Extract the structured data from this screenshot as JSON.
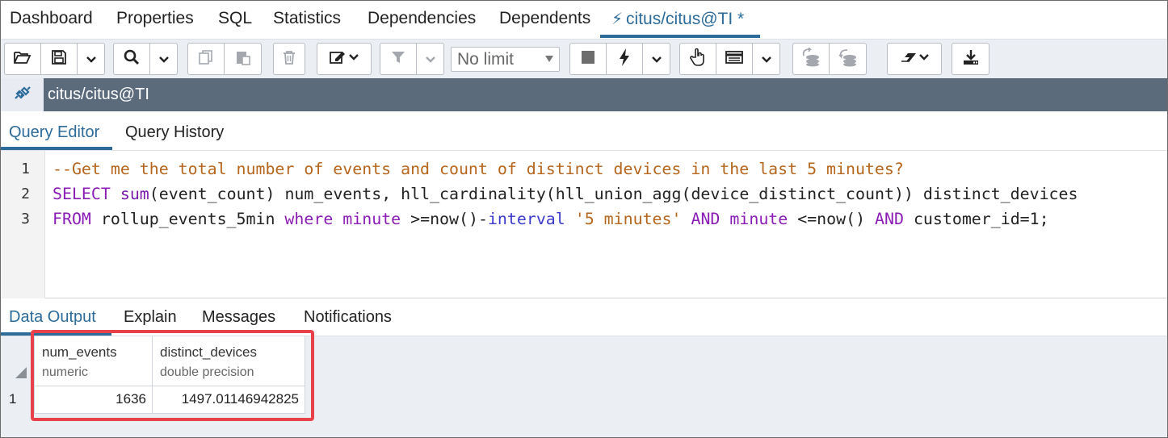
{
  "top_tabs": {
    "dashboard": "Dashboard",
    "properties": "Properties",
    "sql": "SQL",
    "statistics": "Statistics",
    "dependencies": "Dependencies",
    "dependents": "Dependents",
    "query_tab": "citus/citus@TI *"
  },
  "toolbar": {
    "row_limit": "No limit"
  },
  "connection": {
    "label": "citus/citus@TI"
  },
  "editor_tabs": {
    "query_editor": "Query Editor",
    "query_history": "Query History"
  },
  "editor": {
    "line_numbers": [
      "1",
      "2",
      "3"
    ],
    "line1": {
      "comment": "--Get me the total number of events and count of distinct devices in the last 5 minutes?"
    },
    "line2": {
      "kw_select": "SELECT",
      "fn_sum": "sum",
      "p1": "(",
      "arg1": "event_count",
      "p2": ")",
      "alias1": " num_events, hll_cardinality",
      "p3": "(",
      "fn_inner": "hll_union_agg",
      "p4": "(",
      "arg2": "device_distinct_count",
      "p5": "))",
      "alias2": " distinct_devices"
    },
    "line3": {
      "kw_from": "FROM",
      "table": " rollup_events_5min ",
      "kw_where": "where",
      "col_minute1": "minute",
      "op1": " >=now",
      "p1": "()",
      "op2": "-",
      "kw_interval": "interval",
      "str": "'5 minutes'",
      "kw_and1": "AND",
      "col_minute2": "minute",
      "op3": " <=now",
      "p2": "()",
      "kw_and2": "AND",
      "cond": " customer_id=",
      "num": "1",
      "end": ";"
    }
  },
  "output_tabs": {
    "data_output": "Data Output",
    "explain": "Explain",
    "messages": "Messages",
    "notifications": "Notifications"
  },
  "grid": {
    "columns": [
      {
        "name": "num_events",
        "type": "numeric"
      },
      {
        "name": "distinct_devices",
        "type": "double precision"
      }
    ],
    "rows": [
      {
        "rownum": "1",
        "cells": [
          "1636",
          "1497.01146942825"
        ]
      }
    ]
  },
  "colors": {
    "accent": "#2c6b9a",
    "highlight": "#e8414a",
    "connection_bar": "#5b6b7c"
  },
  "icons": [
    "open-file-icon",
    "save-icon",
    "find-icon",
    "copy-icon",
    "paste-icon",
    "delete-icon",
    "edit-icon",
    "filter-icon",
    "stop-icon",
    "execute-icon",
    "explain-icon",
    "macros-icon",
    "commit-icon",
    "rollback-icon",
    "clear-icon",
    "download-icon",
    "connection-status-icon"
  ]
}
